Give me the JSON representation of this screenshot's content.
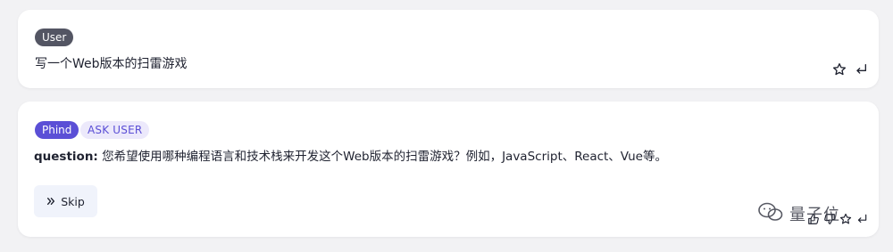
{
  "user_message": {
    "role_badge": "User",
    "text": "写一个Web版本的扫雷游戏",
    "actions": [
      {
        "icon": "star-icon"
      },
      {
        "icon": "reply-arrow-icon"
      }
    ]
  },
  "ai_message": {
    "role_badge": "Phind",
    "mode_badge": "ASK USER",
    "question_label": "question:",
    "question_text": " 您希望使用哪种编程语言和技术栈来开发这个Web版本的扫雷游戏？例如，JavaScript、React、Vue等。",
    "skip_button": {
      "icon": "double-chevron-right-icon",
      "label": "Skip"
    },
    "actions": [
      {
        "icon": "thumbs-up-icon"
      },
      {
        "icon": "thumbs-down-icon"
      },
      {
        "icon": "star-icon"
      },
      {
        "icon": "reply-arrow-icon"
      }
    ]
  },
  "watermark": {
    "icon": "wechat-icon",
    "text": "量子位"
  },
  "colors": {
    "background": "#f2f2f4",
    "card": "#ffffff",
    "user_badge": "#535563",
    "phind_badge": "#5b4fd6",
    "ask_badge_bg": "#ece9fb",
    "skip_bg": "#f0f3fb"
  }
}
